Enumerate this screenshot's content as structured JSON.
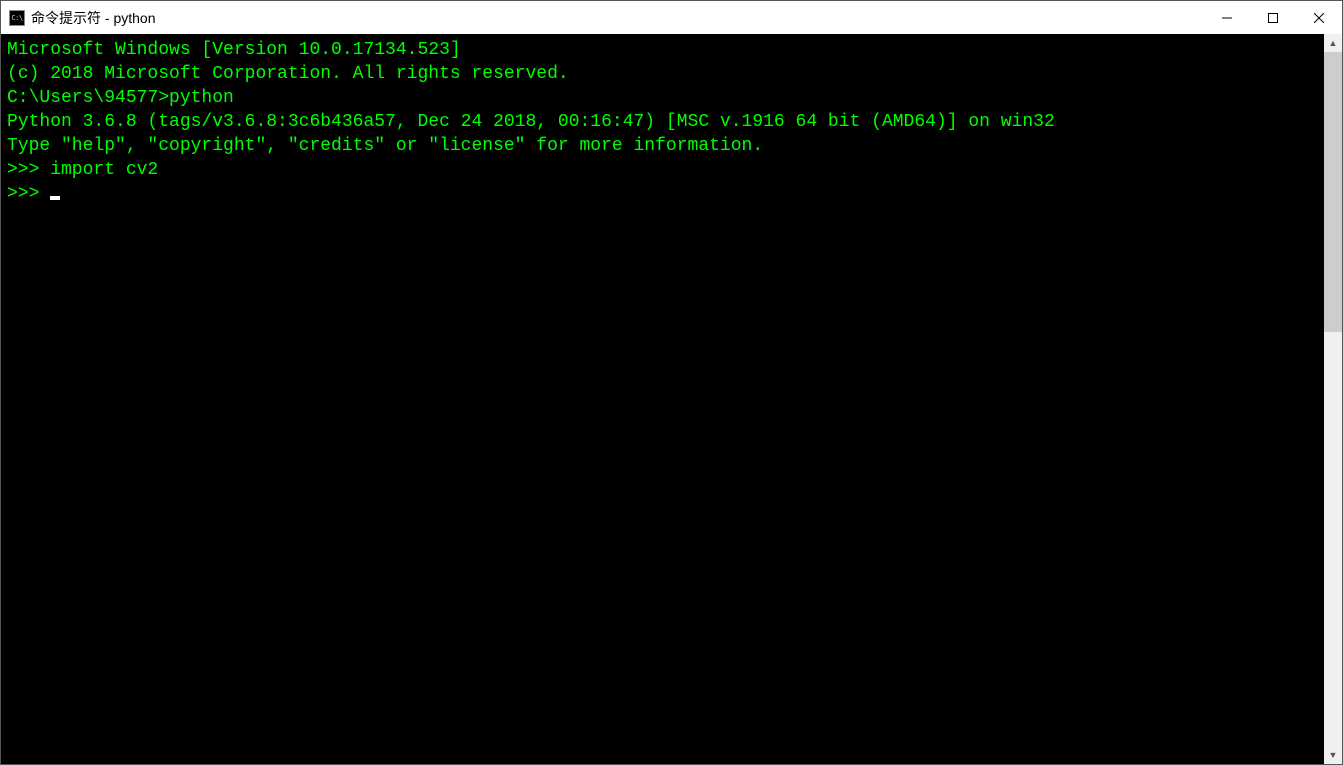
{
  "window": {
    "title": "命令提示符 - python"
  },
  "terminal": {
    "lines": [
      "Microsoft Windows [Version 10.0.17134.523]",
      "(c) 2018 Microsoft Corporation. All rights reserved.",
      "",
      "C:\\Users\\94577>python",
      "Python 3.6.8 (tags/v3.6.8:3c6b436a57, Dec 24 2018, 00:16:47) [MSC v.1916 64 bit (AMD64)] on win32",
      "Type \"help\", \"copyright\", \"credits\" or \"license\" for more information.",
      ">>> import cv2",
      ">>> "
    ],
    "text_color": "#00ff00",
    "background_color": "#000000"
  }
}
